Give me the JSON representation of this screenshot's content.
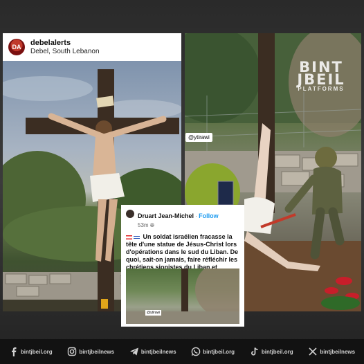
{
  "left_post": {
    "username": "debelalerts",
    "location": "Debel, South Lebanon",
    "avatar_text": "DA"
  },
  "right_post": {
    "tag": "@ytirawi",
    "watermark_main_1": "BINT",
    "watermark_main_2": "JBEIL",
    "watermark_sub": "PLATFORMS"
  },
  "tweet": {
    "author": "Druart Jean-Michel",
    "separator": " · ",
    "follow_label": "Follow",
    "time": "53m",
    "body": "Un soldat israélien fracasse la tête d'une statue de Jésus-Christ lors d'opérations dans le sud du Liban. De quoi, sait-on jamais, faire réfléchir les chrétiens sionistes du Liban et d'ailleurs ?",
    "media_tag": "@ytirawi"
  },
  "social_bar": [
    {
      "icon": "facebook-icon",
      "label": "bintjbeil.org"
    },
    {
      "icon": "instagram-icon",
      "label": "bintjbeilnews"
    },
    {
      "icon": "telegram-icon",
      "label": "bintjbeilnews"
    },
    {
      "icon": "whatsapp-icon",
      "label": "bintjbeil.org"
    },
    {
      "icon": "tiktok-icon",
      "label": "bintjbeil.org"
    },
    {
      "icon": "x-icon",
      "label": "bintjbeilnews"
    }
  ],
  "colors": {
    "twitter_blue": "#1d9bf0",
    "bar_background": "#121212",
    "avatar_red": "#c0392b"
  }
}
